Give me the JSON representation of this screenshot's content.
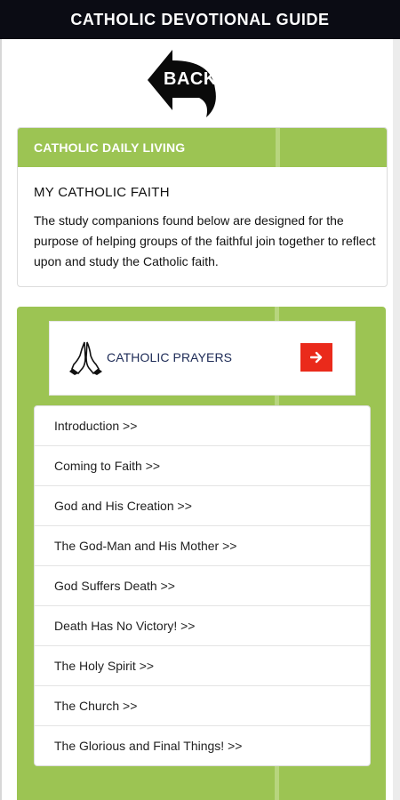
{
  "header": {
    "title": "CATHOLIC DEVOTIONAL GUIDE"
  },
  "back_button": {
    "label": "BACK"
  },
  "panel": {
    "title": "CATHOLIC DAILY LIVING",
    "subtitle": "MY CATHOLIC FAITH",
    "description": "The study companions found below are designed for the purpose of helping groups of the faithful join together to reflect upon and study the Catholic faith."
  },
  "prayers": {
    "label": "CATHOLIC PRAYERS",
    "icon": "praying-hands-icon",
    "button_icon": "arrow-right-icon"
  },
  "study_items": [
    {
      "label": "Introduction >>"
    },
    {
      "label": "Coming to Faith >>"
    },
    {
      "label": "God and His Creation >>"
    },
    {
      "label": "The God-Man and His Mother >>"
    },
    {
      "label": "God Suffers Death >>"
    },
    {
      "label": "Death Has No Victory! >>"
    },
    {
      "label": "The Holy Spirit >>"
    },
    {
      "label": "The Church >>"
    },
    {
      "label": "The Glorious and Final Things! >>"
    }
  ],
  "colors": {
    "topbar": "#0b0c14",
    "green": "#9cc453",
    "arrow_button": "#ea2a1b",
    "prayers_text": "#1c2a56"
  }
}
